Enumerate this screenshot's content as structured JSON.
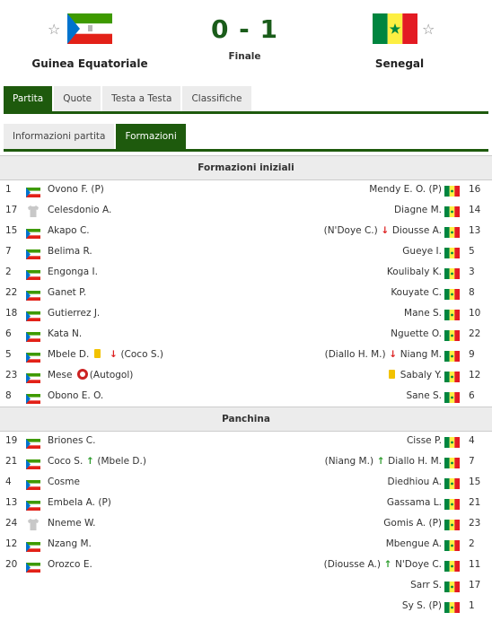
{
  "match": {
    "home_team": "Guinea Equatoriale",
    "away_team": "Senegal",
    "score": "0 - 1",
    "status": "Finale"
  },
  "tabs_main": [
    "Partita",
    "Quote",
    "Testa a Testa",
    "Classifiche"
  ],
  "tabs_sub": [
    "Informazioni partita",
    "Formazioni"
  ],
  "sections": {
    "starting": "Formazioni iniziali",
    "bench": "Panchina"
  },
  "starting": [
    {
      "hnum": "1",
      "hname": "Ovono F. (P)",
      "hflag": "flag",
      "aname": "Mendy E. O. (P)",
      "anum": "16"
    },
    {
      "hnum": "17",
      "hname": "Celesdonio A.",
      "hflag": "shirt",
      "aname": "Diagne M.",
      "anum": "14"
    },
    {
      "hnum": "15",
      "hname": "Akapo C.",
      "hflag": "flag",
      "aname": "Diousse A.",
      "asub": "(N'Doye C.)",
      "asub_dir": "down",
      "anum": "13"
    },
    {
      "hnum": "7",
      "hname": "Belima R.",
      "hflag": "flag",
      "aname": "Gueye I.",
      "anum": "5"
    },
    {
      "hnum": "2",
      "hname": "Engonga I.",
      "hflag": "flag",
      "aname": "Koulibaly K.",
      "anum": "3"
    },
    {
      "hnum": "22",
      "hname": "Ganet P.",
      "hflag": "flag",
      "aname": "Kouyate C.",
      "anum": "8"
    },
    {
      "hnum": "18",
      "hname": "Gutierrez J.",
      "hflag": "flag",
      "aname": "Mane S.",
      "anum": "10"
    },
    {
      "hnum": "6",
      "hname": "Kata N.",
      "hflag": "flag",
      "aname": "Nguette O.",
      "anum": "22"
    },
    {
      "hnum": "5",
      "hname": "Mbele D.",
      "hflag": "flag",
      "hcard": "yellow",
      "hsub": "(Coco S.)",
      "hsub_dir": "down",
      "aname": "Niang M.",
      "asub": "(Diallo H. M.)",
      "asub_dir": "down",
      "anum": "9"
    },
    {
      "hnum": "23",
      "hname": "Mese",
      "hflag": "flag",
      "hgoal": "(Autogol)",
      "aname": "Sabaly Y.",
      "acard": "yellow",
      "anum": "12"
    },
    {
      "hnum": "8",
      "hname": "Obono E. O.",
      "hflag": "flag",
      "aname": "Sane S.",
      "anum": "6"
    }
  ],
  "bench": [
    {
      "hnum": "19",
      "hname": "Briones C.",
      "hflag": "flag",
      "aname": "Cisse P.",
      "anum": "4"
    },
    {
      "hnum": "21",
      "hname": "Coco S.",
      "hflag": "flag",
      "hsub": "(Mbele D.)",
      "hsub_dir": "up",
      "aname": "Diallo H. M.",
      "asub": "(Niang M.)",
      "asub_dir": "up",
      "anum": "7"
    },
    {
      "hnum": "4",
      "hname": "Cosme",
      "hflag": "flag",
      "aname": "Diedhiou A.",
      "anum": "15"
    },
    {
      "hnum": "13",
      "hname": "Embela A. (P)",
      "hflag": "flag",
      "aname": "Gassama L.",
      "anum": "21"
    },
    {
      "hnum": "24",
      "hname": "Nneme W.",
      "hflag": "shirt",
      "aname": "Gomis A. (P)",
      "anum": "23"
    },
    {
      "hnum": "12",
      "hname": "Nzang M.",
      "hflag": "flag",
      "aname": "Mbengue A.",
      "anum": "2"
    },
    {
      "hnum": "20",
      "hname": "Orozco E.",
      "hflag": "flag",
      "aname": "N'Doye C.",
      "asub": "(Diousse A.)",
      "asub_dir": "up",
      "anum": "11"
    },
    {
      "hnum": "",
      "hname": "",
      "hflag": "",
      "aname": "Sarr S.",
      "anum": "17"
    },
    {
      "hnum": "",
      "hname": "",
      "hflag": "",
      "aname": "Sy S. (P)",
      "anum": "1"
    }
  ],
  "colors": {
    "accent": "#1e5a0d",
    "score": "#1a5c1a",
    "card": "#f2c200",
    "sub_out": "#dd2222",
    "sub_in": "#2a9b2a"
  }
}
